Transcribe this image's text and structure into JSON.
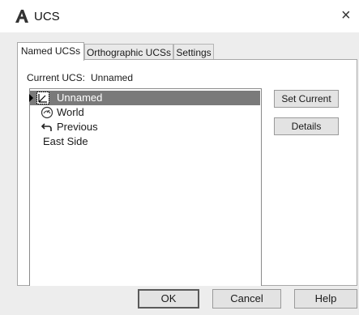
{
  "window": {
    "title": "UCS",
    "close_glyph": "×"
  },
  "tabs": [
    {
      "label": "Named UCSs",
      "active": true
    },
    {
      "label": "Orthographic UCSs",
      "active": false
    },
    {
      "label": "Settings",
      "active": false
    }
  ],
  "current": {
    "label": "Current UCS:",
    "value": "Unnamed"
  },
  "ucs_list": [
    {
      "label": "Unnamed",
      "icon": "ucs-axis-icon",
      "selected": true,
      "current_marker": true
    },
    {
      "label": "World",
      "icon": "world-globe-icon",
      "selected": false
    },
    {
      "label": "Previous",
      "icon": "undo-arrow-icon",
      "selected": false
    },
    {
      "label": "East Side",
      "icon": "",
      "selected": false
    }
  ],
  "side_buttons": {
    "set_current": "Set Current",
    "details": "Details"
  },
  "footer": {
    "ok": "OK",
    "cancel": "Cancel",
    "help": "Help"
  },
  "colors": {
    "selection": "#7a7a7a",
    "dialog_bg": "#ededed",
    "panel_bg": "#ffffff"
  }
}
